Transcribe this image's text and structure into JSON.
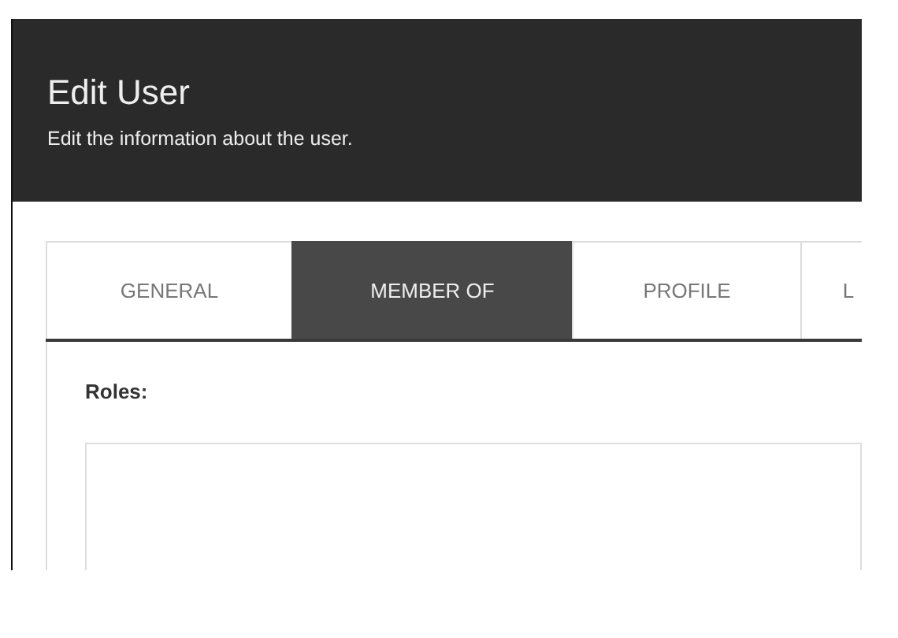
{
  "header": {
    "title": "Edit User",
    "subtitle": "Edit the information about the user."
  },
  "tabs": [
    {
      "label": "GENERAL",
      "selected": false
    },
    {
      "label": "MEMBER OF",
      "selected": true
    },
    {
      "label": "PROFILE",
      "selected": false
    },
    {
      "label": "L",
      "selected": false
    }
  ],
  "roles": {
    "label": "Roles:"
  }
}
